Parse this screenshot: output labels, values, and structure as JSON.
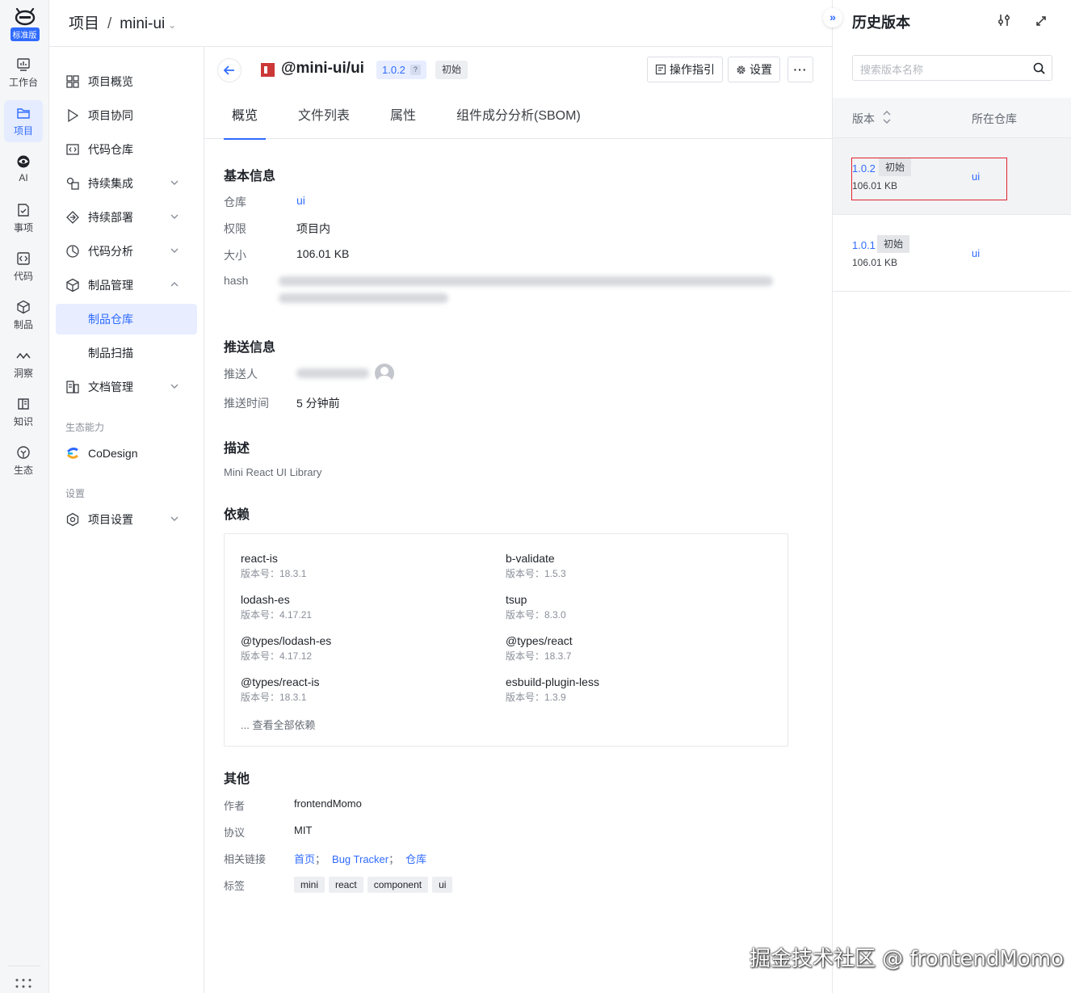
{
  "rail": {
    "edition": "标准版",
    "items": [
      {
        "label": "工作台",
        "icon": "dashboard-icon"
      },
      {
        "label": "项目",
        "icon": "folder-icon"
      },
      {
        "label": "AI",
        "icon": "ai-icon"
      },
      {
        "label": "事项",
        "icon": "task-icon"
      },
      {
        "label": "代码",
        "icon": "code-icon"
      },
      {
        "label": "制品",
        "icon": "package-icon"
      },
      {
        "label": "洞察",
        "icon": "insight-icon"
      },
      {
        "label": "知识",
        "icon": "book-icon"
      },
      {
        "label": "生态",
        "icon": "ecosystem-icon"
      }
    ]
  },
  "breadcrumb": {
    "root": "项目",
    "separator": "/",
    "project": "mini-ui"
  },
  "sidebar": {
    "items": [
      {
        "label": "项目概览",
        "icon": "grid-icon"
      },
      {
        "label": "项目协同",
        "icon": "play-icon"
      },
      {
        "label": "代码仓库",
        "icon": "code-repo-icon"
      },
      {
        "label": "持续集成",
        "icon": "ci-icon"
      },
      {
        "label": "持续部署",
        "icon": "deploy-icon"
      },
      {
        "label": "代码分析",
        "icon": "analysis-icon"
      },
      {
        "label": "制品管理",
        "icon": "package-icon"
      },
      {
        "label": "制品仓库",
        "icon": ""
      },
      {
        "label": "制品扫描",
        "icon": ""
      },
      {
        "label": "文档管理",
        "icon": "doc-icon"
      },
      {
        "label": "CoDesign",
        "icon": "codesign-logo"
      },
      {
        "label": "项目设置",
        "icon": "settings-icon"
      }
    ],
    "group_ecosystem": "生态能力",
    "group_settings": "设置"
  },
  "header": {
    "package_name": "@mini-ui/ui",
    "version": "1.0.2",
    "version_help": "?",
    "stage": "初始",
    "guide_button": "操作指引",
    "settings_button": "设置",
    "more_button": "···"
  },
  "tabs": [
    "概览",
    "文件列表",
    "属性",
    "组件成分分析(SBOM)"
  ],
  "basic": {
    "title": "基本信息",
    "repo_label": "仓库",
    "repo_value": "ui",
    "permission_label": "权限",
    "permission_value": "项目内",
    "size_label": "大小",
    "size_value": "106.01 KB",
    "hash_label": "hash"
  },
  "push": {
    "title": "推送信息",
    "pusher_label": "推送人",
    "time_label": "推送时间",
    "time_value": "5 分钟前"
  },
  "description": {
    "title": "描述",
    "text": "Mini React UI Library"
  },
  "dependencies": {
    "title": "依赖",
    "version_prefix": "版本号：",
    "items": [
      {
        "name": "react-is",
        "version": "版本号：18.3.1"
      },
      {
        "name": "b-validate",
        "version": "版本号：1.5.3"
      },
      {
        "name": "lodash-es",
        "version": "版本号：4.17.21"
      },
      {
        "name": "tsup",
        "version": "版本号：8.3.0"
      },
      {
        "name": "@types/lodash-es",
        "version": "版本号：4.17.12"
      },
      {
        "name": "@types/react",
        "version": "版本号：18.3.7"
      },
      {
        "name": "@types/react-is",
        "version": "版本号：18.3.1"
      },
      {
        "name": "esbuild-plugin-less",
        "version": "版本号：1.3.9"
      }
    ],
    "more": "... 查看全部依赖"
  },
  "other": {
    "title": "其他",
    "author_label": "作者",
    "author_value": "frontendMomo",
    "license_label": "协议",
    "license_value": "MIT",
    "links_label": "相关链接",
    "links": [
      "首页",
      "Bug Tracker",
      "仓库"
    ],
    "link_separator": "；",
    "tags_label": "标签",
    "tags": [
      "mini",
      "react",
      "component",
      "ui"
    ]
  },
  "history": {
    "collapse_icon": "»",
    "title": "历史版本",
    "search_placeholder": "搜索版本名称",
    "col_version": "版本",
    "col_repo": "所在仓库",
    "rows": [
      {
        "version": "1.0.2",
        "stage": "初始",
        "size": "106.01 KB",
        "repo": "ui",
        "selected": true
      },
      {
        "version": "1.0.1",
        "stage": "初始",
        "size": "106.01 KB",
        "repo": "ui",
        "selected": false
      }
    ]
  },
  "watermark": "掘金技术社区 @ frontendMomo",
  "colors": {
    "accent": "#2f6bff",
    "npm_red": "#cb3837",
    "highlight_red": "#e0242f"
  }
}
